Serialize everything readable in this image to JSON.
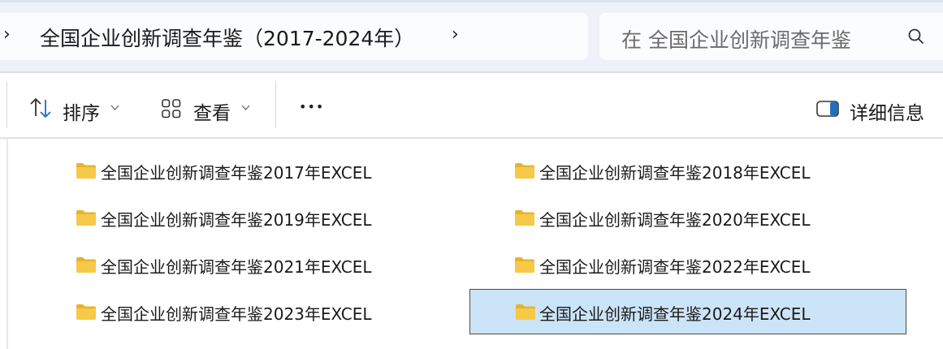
{
  "address": {
    "path": "全国企业创新调查年鉴（2017-2024年）",
    "nav_left_glyph": "›",
    "nav_right_glyph": "›"
  },
  "search": {
    "placeholder": "在 全国企业创新调查年鉴",
    "icon": "search-icon"
  },
  "toolbar": {
    "sort_label": "排序",
    "sort_icon": "sort-arrows-icon",
    "view_label": "查看",
    "view_icon": "grid-view-icon",
    "more_label": "•••",
    "details_label": "详细信息",
    "details_icon": "details-pane-icon"
  },
  "items": [
    {
      "label": "全国企业创新调查年鉴2017年EXCEL",
      "selected": false
    },
    {
      "label": "全国企业创新调查年鉴2018年EXCEL",
      "selected": false
    },
    {
      "label": "全国企业创新调查年鉴2019年EXCEL",
      "selected": false
    },
    {
      "label": "全国企业创新调查年鉴2020年EXCEL",
      "selected": false
    },
    {
      "label": "全国企业创新调查年鉴2021年EXCEL",
      "selected": false
    },
    {
      "label": "全国企业创新调查年鉴2022年EXCEL",
      "selected": false
    },
    {
      "label": "全国企业创新调查年鉴2023年EXCEL",
      "selected": false
    },
    {
      "label": "全国企业创新调查年鉴2024年EXCEL",
      "selected": true
    }
  ],
  "colors": {
    "folder": "#f7c948",
    "folder_dark": "#e8b32c",
    "selection_bg": "#cce4f7",
    "band_bg": "#eef1f7"
  }
}
